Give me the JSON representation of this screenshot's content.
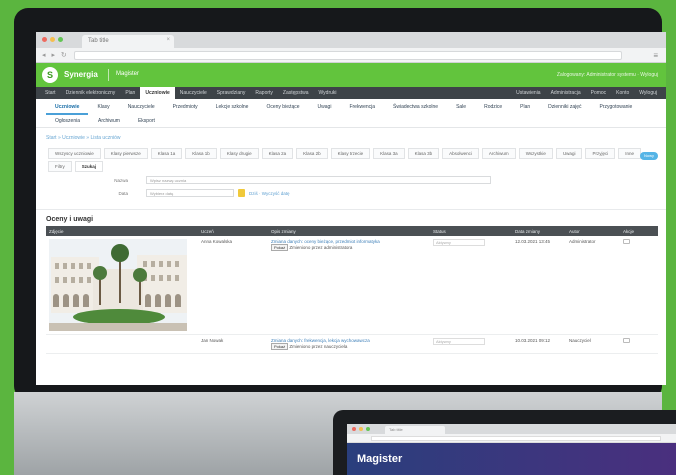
{
  "browser": {
    "tab_title": "Tab title",
    "nav_buttons": "◂ ▸ ↻",
    "menu_icon": "≡"
  },
  "app": {
    "logo_letter": "S",
    "name": "Synergia",
    "sub_name": "Magister",
    "user_info": "Zalogowany: Administrator systemu · Wyloguj"
  },
  "dark_nav": {
    "items": [
      "Start",
      "Dziennik elektroniczny",
      "Plan",
      "Uczniowie",
      "Nauczyciele",
      "Sprawdziany",
      "Raporty",
      "Zastępstwa",
      "Wydruki"
    ],
    "active_index": 3,
    "right_items": [
      "Ustawienia",
      "Administracja",
      "Pomoc",
      "Konto",
      "Wyloguj"
    ]
  },
  "sub_nav": {
    "items": [
      "Uczniowie",
      "Klasy",
      "Nauczyciele",
      "Przedmioty",
      "Lekcje szkolne",
      "Oceny bieżące",
      "Uwagi",
      "Frekwencja",
      "Świadectwa szkolne",
      "Sale",
      "Rodzice",
      "Plan",
      "Dzienniki zajęć",
      "Przygotowanie",
      "Ogłoszenia",
      "Archiwum",
      "Eksport"
    ],
    "active_index": 0
  },
  "breadcrumb": "Start » Uczniowie » Lista uczniów",
  "new_button": "Nowy",
  "filter_tabs": {
    "items": [
      "Wszyscy uczniowie",
      "Klasy pierwsze",
      "Klasa 1a",
      "Klasa 1b",
      "Klasy drugie",
      "Klasa 2a",
      "Klasa 2b",
      "Klasy trzecie",
      "Klasa 3a",
      "Klasa 3b",
      "Absolwenci",
      "Archiwum",
      "Wszystkie",
      "Uwagi",
      "Przyjęci",
      "Inne",
      "Filtry"
    ],
    "last_label": "Szukaj"
  },
  "search": {
    "label_name": "Nazwa",
    "value_name": "Wpisz nazwę ucznia",
    "label_date": "Data",
    "value_date": "Wybierz datę",
    "today_link": "Dziś · Wyczyść datę"
  },
  "section_title": "Oceny i uwagi",
  "table": {
    "headers": [
      "Zdjęcie",
      "Uczeń",
      "Opis zmiany",
      "Status",
      "Data zmiany",
      "Autor",
      "Akcje"
    ],
    "rows": [
      {
        "student": "Anna Kowalska",
        "desc_line1": "Zmiana danych: oceny bieżące, przedmiot informatyka",
        "desc_btn": "Pokaż",
        "desc_line2": "Zmieniono przez administratora",
        "status": "Aktywny",
        "date": "12.03.2021 13:45",
        "author": "Administrator"
      },
      {
        "student": "Jan Nowak",
        "desc_line1": "Zmiana danych: frekwencja, lekcja wychowawcza",
        "desc_btn": "Pokaż",
        "desc_line2": "Zmieniono przez nauczyciela",
        "status": "Aktywny",
        "date": "10.03.2021 09:12",
        "author": "Nauczyciel"
      }
    ]
  },
  "laptop": {
    "tab_title": "Tab title",
    "hero_title": "Magister"
  },
  "colors": {
    "background": "#5bb53f",
    "app_header": "#62c43d",
    "dark_nav": "#3d4348",
    "accent_link": "#3d7fb8"
  }
}
